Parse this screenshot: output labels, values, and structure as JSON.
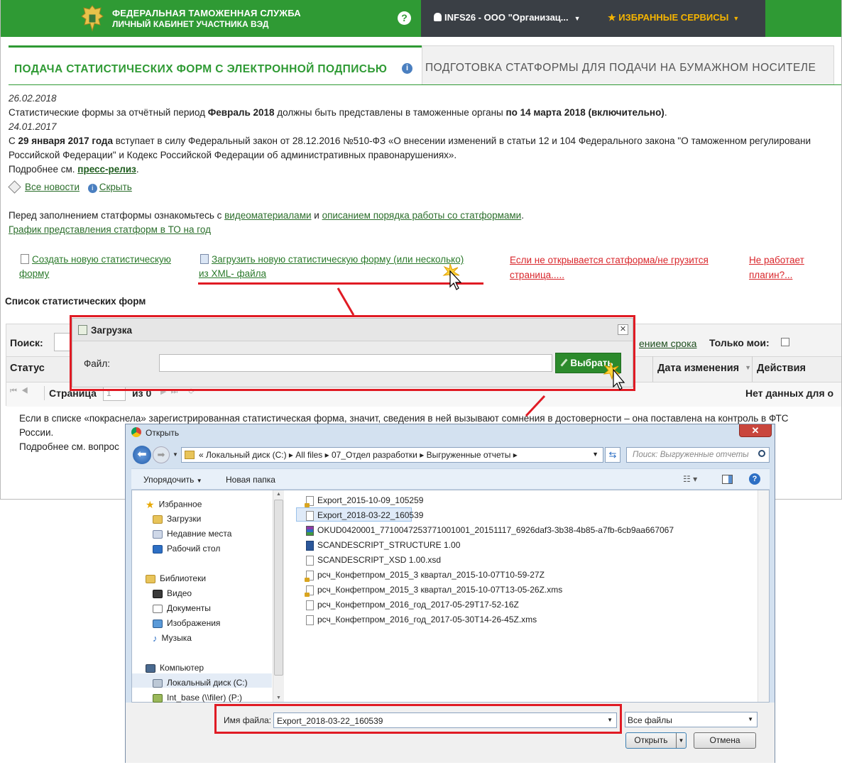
{
  "header": {
    "brand_line1": "ФЕДЕРАЛЬНАЯ ТАМОЖЕННАЯ СЛУЖБА",
    "brand_line2": "ЛИЧНЫЙ КАБИНЕТ УЧАСТНИКА ВЭД",
    "help": "?",
    "user": "INFS26 - ООО \"Организац...",
    "favorites": "★ ИЗБРАННЫЕ СЕРВИСЫ"
  },
  "tabs": {
    "active": "ПОДАЧА СТАТИСТИЧЕСКИХ ФОРМ С ЭЛЕКТРОННОЙ ПОДПИСЬЮ",
    "inactive": "ПОДГОТОВКА СТАТФОРМЫ ДЛЯ ПОДАЧИ НА БУМАЖНОМ НОСИТЕЛЕ"
  },
  "news": {
    "date1": "26.02.2018",
    "n1_a": "Статистические формы за отчётный период ",
    "n1_b": "Февраль 2018",
    "n1_c": " должны быть представлены в таможенные органы ",
    "n1_d": "по 14 марта 2018 (включительно)",
    "n1_e": ".",
    "date2": "24.01.2017",
    "n2_a": "С ",
    "n2_b": "29 января 2017 года",
    "n2_c": " вступает в силу Федеральный закон от 28.12.2016 №510-ФЗ «О внесении изменений в статьи 12 и 104 Федерального закона \"О таможенном регулировани",
    "n2_line2": "Российской Федерации\" и Кодекс Российской Федерации об административных правонарушениях».",
    "n2_more": "Подробнее см. ",
    "n2_link": "пресс-релиз",
    "all_news": "Все новости",
    "hide": "Скрыть"
  },
  "intro": {
    "a": "Перед заполнением статформы ознакомьтесь с ",
    "link1": "видеоматериалами",
    "b": " и ",
    "link2": "описанием порядка работы со статформами",
    "c": ".",
    "schedule": "График представления статформ в ТО на год"
  },
  "actions": {
    "create_1": "Создать новую статистическую",
    "create_2": "форму",
    "upload_1": "Загрузить новую статистическую форму (или несколько)",
    "upload_2": "из XML- файла",
    "help1_1": "Если не открывается статформа/не грузится",
    "help1_2": "страница.....",
    "help2_1": "Не работает",
    "help2_2": "плагин?..."
  },
  "list": {
    "title": "Список статистических форм",
    "search": "Поиск:",
    "deadline": "ением срока",
    "only_mine": "Только мои:",
    "col_status": "Статус",
    "col_changed": "Дата изменения",
    "col_actions": "Действия",
    "page": "Страница",
    "page_num": "1",
    "of": "из 0",
    "no_data": "Нет данных для о"
  },
  "warning": {
    "line1": "Если в списке «покраснела» зарегистрированная статистическая форма, значит, сведения в ней вызывают сомнения в достоверности – она поставлена на контроль в ФТС",
    "line2": "России.",
    "line3": "Подробнее см. вопрос"
  },
  "upload_dialog": {
    "title": "Загрузка",
    "close": "✕",
    "file_label": "Файл:",
    "file_value": "",
    "choose": "Выбрать"
  },
  "open_dialog": {
    "title": "Открыть",
    "close": "✕",
    "breadcrumbs": [
      "Локальный диск (C:)",
      "All files",
      "07_Отдел разработки",
      "Выгруженные отчеты"
    ],
    "search_placeholder": "Поиск: Выгруженные отчеты",
    "organize": "Упорядочить",
    "new_folder": "Новая папка",
    "nav": {
      "favorites": "Избранное",
      "downloads": "Загрузки",
      "recent": "Недавние места",
      "desktop": "Рабочий стол",
      "libraries": "Библиотеки",
      "video": "Видео",
      "documents": "Документы",
      "images": "Изображения",
      "music": "Музыка",
      "computer": "Компьютер",
      "local_disk": "Локальный диск (C:)",
      "int_base": "Int_base (\\\\filer) (P:)"
    },
    "files": [
      {
        "name": "Export_2015-10-09_105259",
        "icon": "lock"
      },
      {
        "name": "Export_2018-03-22_160539",
        "icon": "blank"
      },
      {
        "name": "OKUD0420001_7710047253771001001_20151117_6926daf3-3b38-4b85-a7fb-6cb9aa667067",
        "icon": "rar"
      },
      {
        "name": "SCANDESCRIPT_STRUCTURE 1.00",
        "icon": "doc"
      },
      {
        "name": "SCANDESCRIPT_XSD 1.00.xsd",
        "icon": "blank"
      },
      {
        "name": "рсч_Конфетпром_2015_3 квартал_2015-10-07T10-59-27Z",
        "icon": "lock"
      },
      {
        "name": "рсч_Конфетпром_2015_3 квартал_2015-10-07T13-05-26Z.xms",
        "icon": "lock"
      },
      {
        "name": "рсч_Конфетпром_2016_год_2017-05-29T17-52-16Z",
        "icon": "blank"
      },
      {
        "name": "рсч_Конфетпром_2016_год_2017-05-30T14-26-45Z.xms",
        "icon": "blank"
      }
    ],
    "filename_label": "Имя файла:",
    "filename_value": "Export_2018-03-22_160539",
    "filter": "Все файлы",
    "open": "Открыть",
    "cancel": "Отмена"
  }
}
